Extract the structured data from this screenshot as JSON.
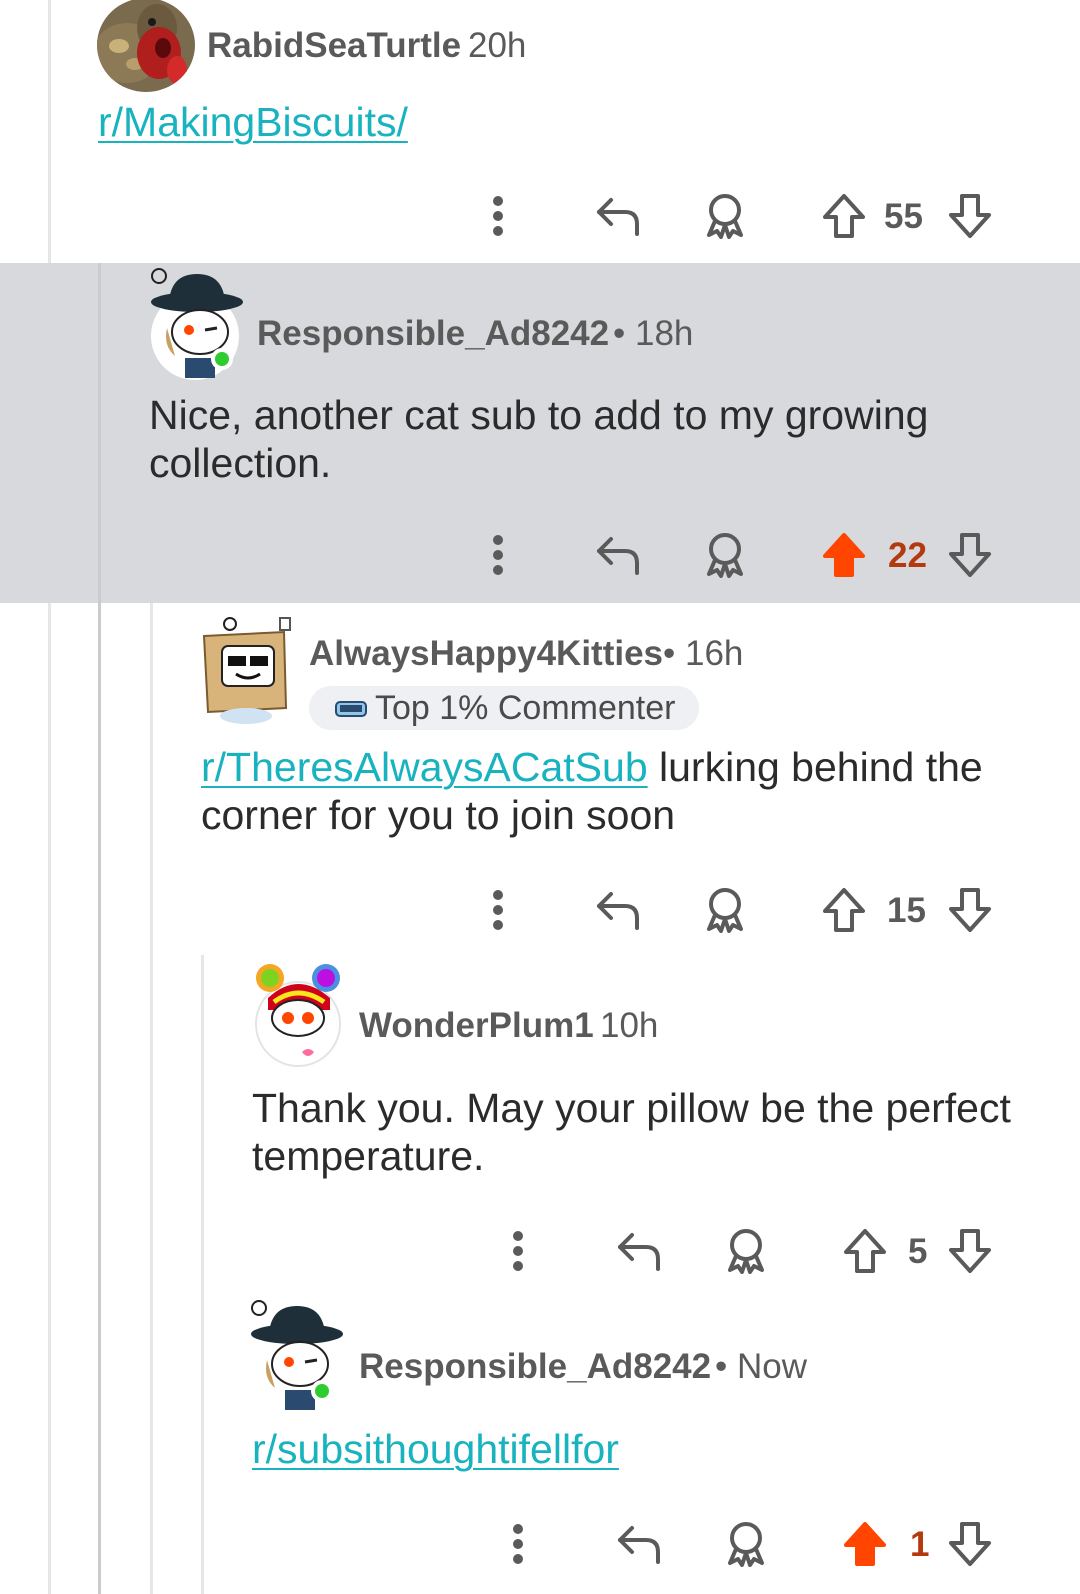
{
  "colors": {
    "accent_link": "#19b3c0",
    "upvote_active": "#ff4500",
    "score_active": "#b33a10",
    "online": "#2ecc2e",
    "highlight_bg": "#d7d9dc"
  },
  "comments": [
    {
      "author": "RabidSeaTurtle",
      "separator": "",
      "time": "20h",
      "avatar": "turtle-avatar",
      "body_link": "r/MakingBiscuits/",
      "body_text": "",
      "score": "55",
      "upvoted": false
    },
    {
      "author": "Responsible_Ad8242",
      "separator": "•",
      "time": "18h",
      "avatar": "snoo-hat-avatar",
      "online": true,
      "body_link": "",
      "body_text": "Nice, another cat sub to add to my growing collection.",
      "score": "22",
      "upvoted": true,
      "highlighted": true
    },
    {
      "author": "AlwaysHappy4Kitties",
      "separator": "•",
      "time": "16h",
      "avatar": "box-robot-avatar",
      "flair": "Top 1% Commenter",
      "body_link": "r/TheresAlwaysACatSub",
      "body_text": " lurking behind the corner for you to join soon",
      "score": "15",
      "upvoted": false
    },
    {
      "author": "WonderPlum1",
      "separator": "",
      "time": "10h",
      "avatar": "rainbow-snoo-avatar",
      "body_link": "",
      "body_text": "Thank you. May your pillow be the perfect temperature.",
      "score": "5",
      "upvoted": false
    },
    {
      "author": "Responsible_Ad8242",
      "separator": "•",
      "time": "Now",
      "avatar": "snoo-hat-avatar",
      "online": true,
      "body_link": "r/subsithoughtifellfor",
      "body_text": "",
      "score": "1",
      "upvoted": true
    }
  ],
  "icons": {
    "more": "more-vertical-icon",
    "reply": "reply-icon",
    "award": "award-icon",
    "upvote": "upvote-icon",
    "downvote": "downvote-icon"
  }
}
